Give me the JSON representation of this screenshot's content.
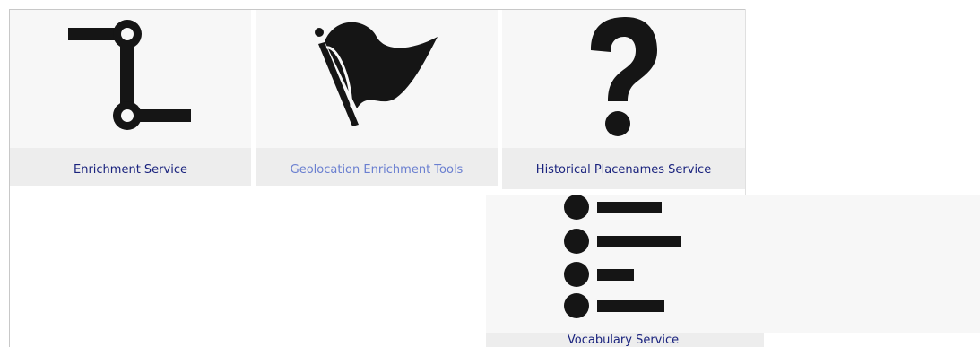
{
  "tiles": [
    {
      "label": "Enrichment Service",
      "icon": "route-icon",
      "muted": false
    },
    {
      "label": "Geolocation Enrichment Tools",
      "icon": "flag-icon",
      "muted": true
    },
    {
      "label": "Historical Placenames Service",
      "icon": "question-mark-icon",
      "muted": false
    },
    {
      "label": "Vocabulary Service",
      "icon": "list-icon",
      "muted": false
    }
  ],
  "colors": {
    "icon_fill": "#151515",
    "tile_background": "#f7f7f7",
    "label_background": "#ededed",
    "link_color": "#1a237e",
    "muted_link_color": "#6a7fd0"
  }
}
